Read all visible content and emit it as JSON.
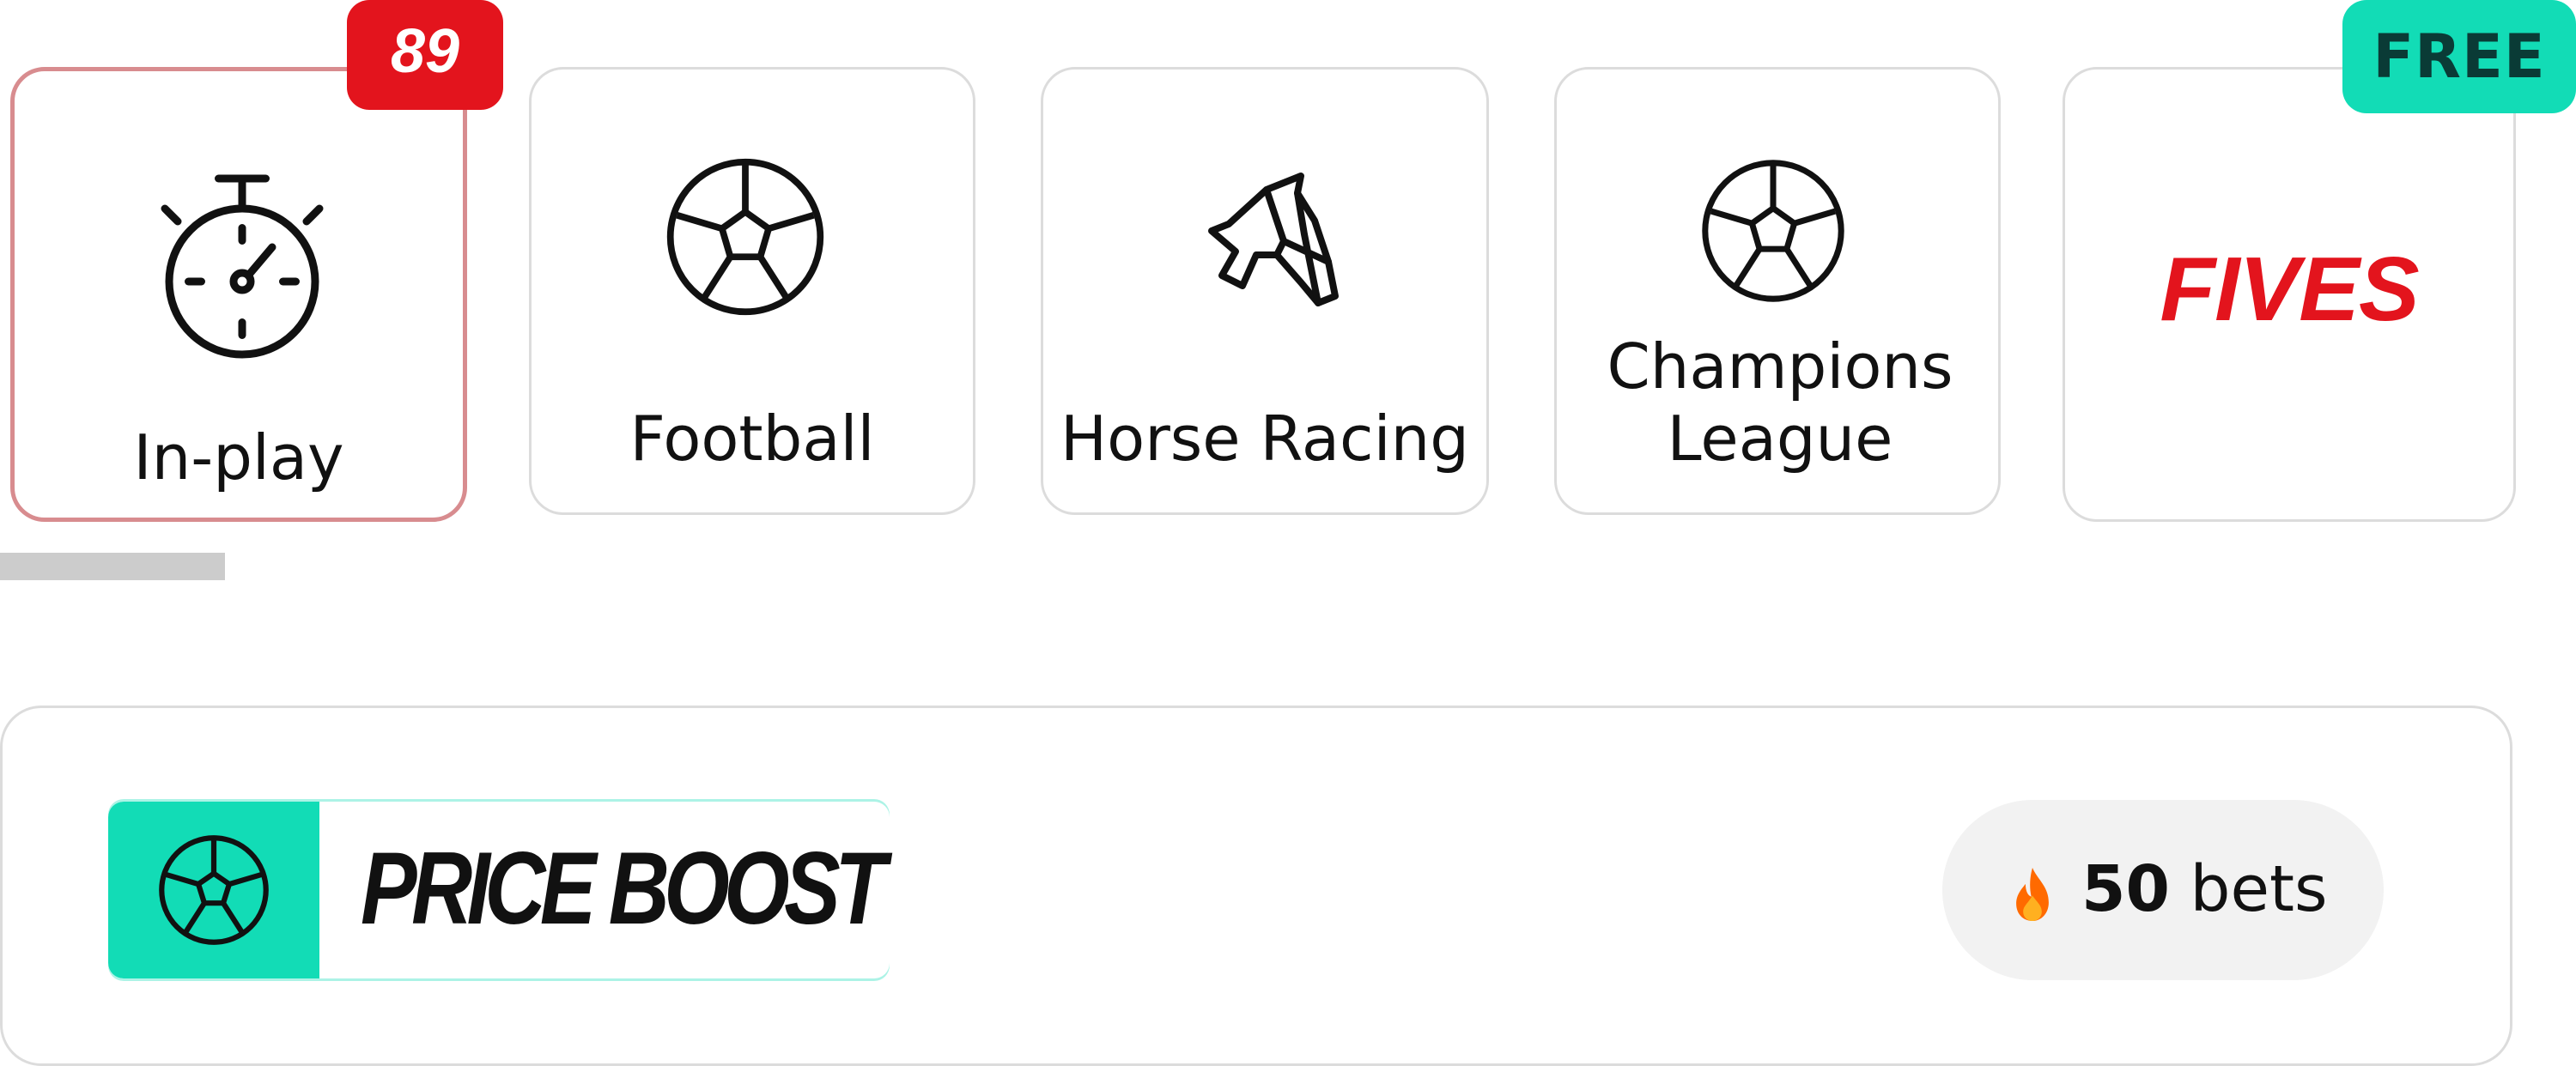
{
  "categories": {
    "items": [
      {
        "id": "in-play",
        "label": "In-play",
        "icon": "stopwatch-icon",
        "active": true,
        "count_badge": "89"
      },
      {
        "id": "football",
        "label": "Football",
        "icon": "football-icon"
      },
      {
        "id": "horse-racing",
        "label": "Horse Racing",
        "icon": "horse-head-icon"
      },
      {
        "id": "champions-league",
        "label": "Champions League",
        "icon": "football-icon"
      },
      {
        "id": "fives",
        "label": "FIVES",
        "badge": "FREE"
      }
    ]
  },
  "promo": {
    "title": "PRICE BOOST",
    "icon": "football-icon",
    "bets_icon": "flame-icon",
    "bets_count": "50",
    "bets_label": "bets"
  },
  "colors": {
    "accent_red": "#e3141d",
    "accent_teal": "#12dcb6",
    "active_border": "#d88c8f",
    "tile_border": "#dcdcdc"
  }
}
